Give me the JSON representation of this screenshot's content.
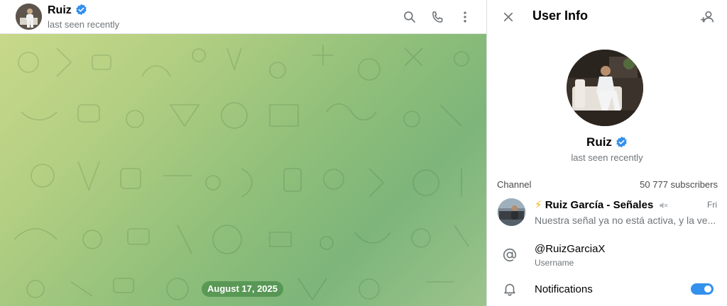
{
  "chat": {
    "name": "Ruiz",
    "status": "last seen recently",
    "date_pill": "August 17, 2025",
    "icons": [
      "search-icon",
      "phone-icon",
      "more-vertical-icon"
    ]
  },
  "info_panel": {
    "title": "User Info",
    "name": "Ruiz",
    "status": "last seen recently",
    "channel": {
      "section_label": "Channel",
      "subscribers": "50 777 subscribers",
      "title_prefix": "⚡",
      "title": "Ruiz García - Señales",
      "date": "Fri",
      "last_message": "Nuestra señal ya no está activa, y la ve..."
    },
    "username": {
      "value": "@RuizGarciaX",
      "label": "Username"
    },
    "notifications": {
      "label": "Notifications",
      "enabled": true
    }
  },
  "colors": {
    "accent": "#3390ec",
    "verified": "#3390ec",
    "date_pill_bg": "#4a8c4a",
    "muted_text": "#707579"
  }
}
